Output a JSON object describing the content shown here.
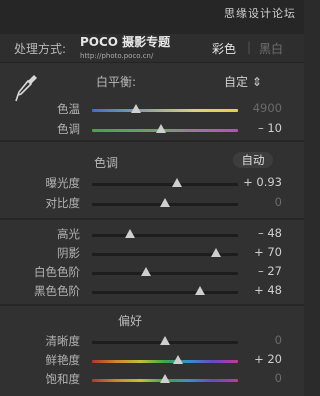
{
  "watermark": "思缘设计论坛",
  "header": {
    "treatment_label": "处理方式:",
    "logo_main": "POCO 摄影专题",
    "logo_sub": "http://photo.poco.cn/",
    "mode_color": "彩色",
    "mode_separator": "|",
    "mode_bw": "黑白"
  },
  "white_balance": {
    "label": "白平衡:",
    "value": "自定 ⇕",
    "sliders": [
      {
        "label": "色温",
        "value": "4900",
        "position": 0.3,
        "dim": true,
        "track": "temp"
      },
      {
        "label": "色调",
        "value": "– 10",
        "position": 0.47,
        "dim": false,
        "track": "tint"
      }
    ]
  },
  "tone": {
    "title": "色调",
    "auto_label": "自动",
    "sliders_a": [
      {
        "label": "曝光度",
        "value": "+ 0.93",
        "position": 0.58,
        "dim": false
      },
      {
        "label": "对比度",
        "value": "0",
        "position": 0.5,
        "dim": true
      }
    ],
    "sliders_b": [
      {
        "label": "高光",
        "value": "– 48",
        "position": 0.26,
        "dim": false
      },
      {
        "label": "阴影",
        "value": "+ 70",
        "position": 0.85,
        "dim": false
      },
      {
        "label": "白色色阶",
        "value": "– 27",
        "position": 0.37,
        "dim": false
      },
      {
        "label": "黑色色阶",
        "value": "+ 48",
        "position": 0.74,
        "dim": false
      }
    ]
  },
  "presence": {
    "title": "偏好",
    "sliders": [
      {
        "label": "清晰度",
        "value": "0",
        "position": 0.5,
        "dim": true,
        "track": "plain"
      },
      {
        "label": "鲜艳度",
        "value": "+ 20",
        "position": 0.59,
        "dim": false,
        "track": "rainbow"
      },
      {
        "label": "饱和度",
        "value": "0",
        "position": 0.5,
        "dim": true,
        "track": "rainbow"
      }
    ]
  }
}
